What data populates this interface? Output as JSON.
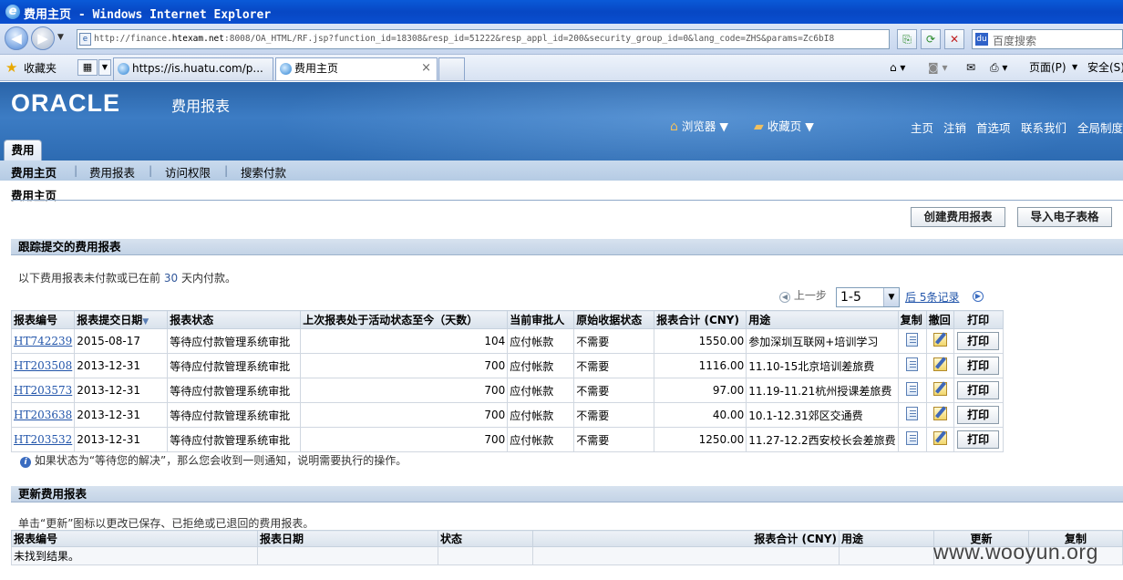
{
  "window": {
    "title": "费用主页 - Windows Internet Explorer"
  },
  "address": {
    "url_prefix": "http://finance.",
    "url_host": "htexam.net",
    "url_rest": ":8008/OA_HTML/RF.jsp?function_id=18308&resp_id=51222&resp_appl_id=200&security_group_id=0&lang_code=ZHS&params=Zc6bI8",
    "search_placeholder": "百度搜索"
  },
  "favbar": {
    "favorites_label": "收藏夹",
    "tabs": [
      {
        "label": "https://is.huatu.com/p..."
      },
      {
        "label": "费用主页"
      }
    ],
    "page_menu": "页面(P)",
    "safety_menu": "安全(S)"
  },
  "banner": {
    "logo": "ORACLE",
    "app_name": "费用报表",
    "browser_menu": "浏览器",
    "favorites_menu": "收藏页",
    "links": [
      "主页",
      "注销",
      "首选项",
      "联系我们",
      "全局制度"
    ]
  },
  "app_tab": "费用",
  "subnav": [
    "费用主页",
    "费用报表",
    "访问权限",
    "搜索付款"
  ],
  "page_title": "费用主页",
  "buttons": {
    "create": "创建费用报表",
    "import": "导入电子表格"
  },
  "track_section": {
    "title": "跟踪提交的费用报表",
    "note_prefix": "以下费用报表未付款或已在前",
    "note_days": "30",
    "note_suffix": "天内付款。",
    "pager_prev": "上一步",
    "pager_range": "1-5",
    "pager_next": "后 5条记录",
    "columns": [
      "报表编号",
      "报表提交日期",
      "报表状态",
      "上次报表处于活动状态至今（天数）",
      "当前审批人",
      "原始收据状态",
      "报表合计 (CNY)",
      "用途",
      "复制",
      "撤回",
      "打印"
    ],
    "print_label": "打印",
    "rows": [
      {
        "id": "HT742239",
        "date": "2015-08-17",
        "status": "等待应付款管理系统审批",
        "days": "104",
        "approver": "应付帐款",
        "receipt": "不需要",
        "total": "1550.00",
        "purpose": "参加深圳互联网+培训学习"
      },
      {
        "id": "HT203508",
        "date": "2013-12-31",
        "status": "等待应付款管理系统审批",
        "days": "700",
        "approver": "应付帐款",
        "receipt": "不需要",
        "total": "1116.00",
        "purpose": "11.10-15北京培训差旅费"
      },
      {
        "id": "HT203573",
        "date": "2013-12-31",
        "status": "等待应付款管理系统审批",
        "days": "700",
        "approver": "应付帐款",
        "receipt": "不需要",
        "total": "97.00",
        "purpose": "11.19-11.21杭州授课差旅费"
      },
      {
        "id": "HT203638",
        "date": "2013-12-31",
        "status": "等待应付款管理系统审批",
        "days": "700",
        "approver": "应付帐款",
        "receipt": "不需要",
        "total": "40.00",
        "purpose": "10.1-12.31郊区交通费"
      },
      {
        "id": "HT203532",
        "date": "2013-12-31",
        "status": "等待应付款管理系统审批",
        "days": "700",
        "approver": "应付帐款",
        "receipt": "不需要",
        "total": "1250.00",
        "purpose": "11.27-12.2西安校长会差旅费"
      }
    ],
    "tip": "如果状态为“等待您的解决”，那么您会收到一则通知，说明需要执行的操作。"
  },
  "update_section": {
    "title": "更新费用报表",
    "note": "单击“更新”图标以更改已保存、已拒绝或已退回的费用报表。",
    "columns": [
      "报表编号",
      "报表日期",
      "状态",
      "报表合计 (CNY)",
      "用途",
      "更新",
      "复制"
    ],
    "empty": "未找到结果。"
  },
  "watermark": "www.wooyun.org"
}
